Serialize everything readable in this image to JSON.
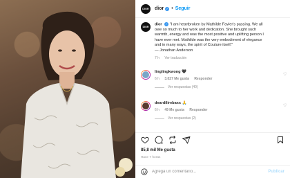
{
  "post": {
    "username": "dior",
    "avatar_text": "DIOR",
    "follow_label": "Seguir",
    "caption_lines": [
      "\"I am heartbroken by Mathilde Favier's passing. We all",
      "owe so much to her work and dedication. She brought such",
      "warmth, energy and was the most positive and uplifting person I",
      "have ever met. Mathilde was the very embodiment of elegance",
      "and in many ways, the spirit of Couture itself.\"",
      "— Jonathan Anderson"
    ],
    "caption_time": "7 h",
    "see_translation": "Ver traducción",
    "likes": "85,8 mil Me gusta",
    "posted_time": "Hace 7 horas"
  },
  "comments": [
    {
      "username": "linglingkwong",
      "emoji": "🖤",
      "time": "6 h",
      "likes": "3.027 Me gusta",
      "reply": "Responder",
      "view_replies": "Ver respuestas (40)"
    },
    {
      "username": "deardilirebaxx",
      "emoji": "🙏",
      "time": "6 h",
      "likes": "49 Me gusta",
      "reply": "Responder",
      "view_replies": "Ver respuestas (2)"
    }
  ],
  "composer": {
    "placeholder": "Agrega un comentario...",
    "publish_label": "Publicar"
  },
  "colors": {
    "link_blue": "#0095f6",
    "verified_blue": "#3897f0",
    "muted": "#8e8e8e"
  }
}
